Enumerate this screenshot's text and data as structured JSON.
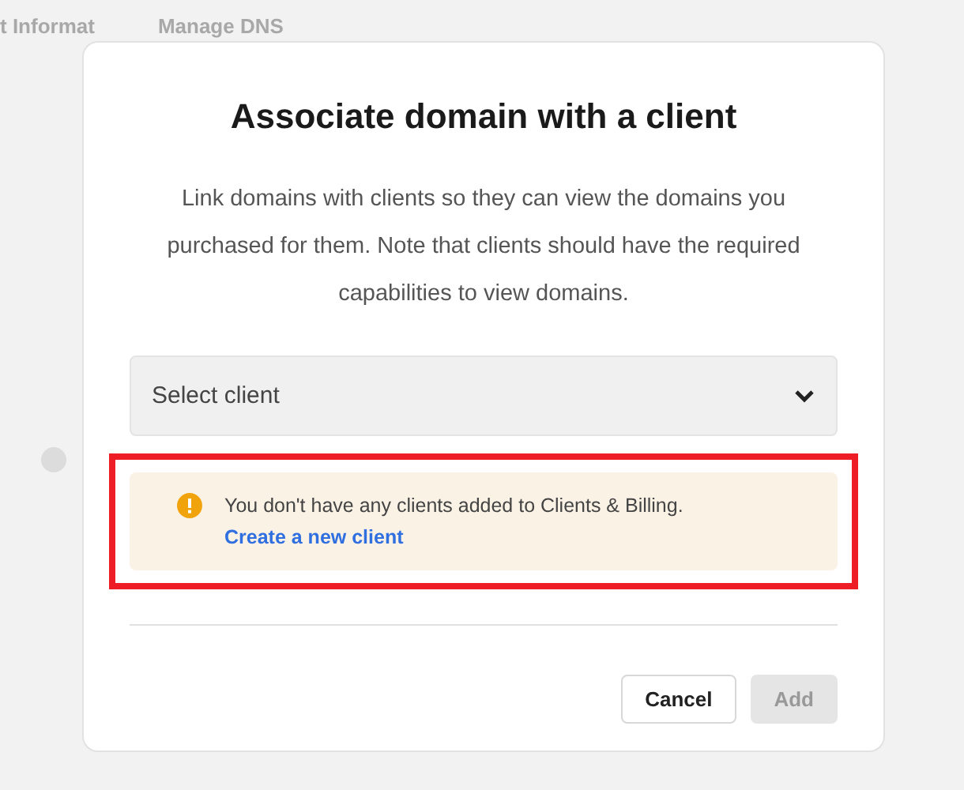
{
  "background": {
    "tabs": [
      "t Informat",
      "Manage DNS"
    ]
  },
  "dialog": {
    "title": "Associate domain with a client",
    "description": "Link domains with clients so they can view the domains you purchased for them. Note that clients should have the required capabilities to view domains.",
    "select": {
      "placeholder": "Select client"
    },
    "notice": {
      "text": "You don't have any clients added to Clients & Billing.",
      "link": "Create a new client",
      "highlighted": true
    },
    "buttons": [
      {
        "label": "Cancel",
        "disabled": false
      },
      {
        "label": "Add",
        "disabled": true
      }
    ]
  }
}
